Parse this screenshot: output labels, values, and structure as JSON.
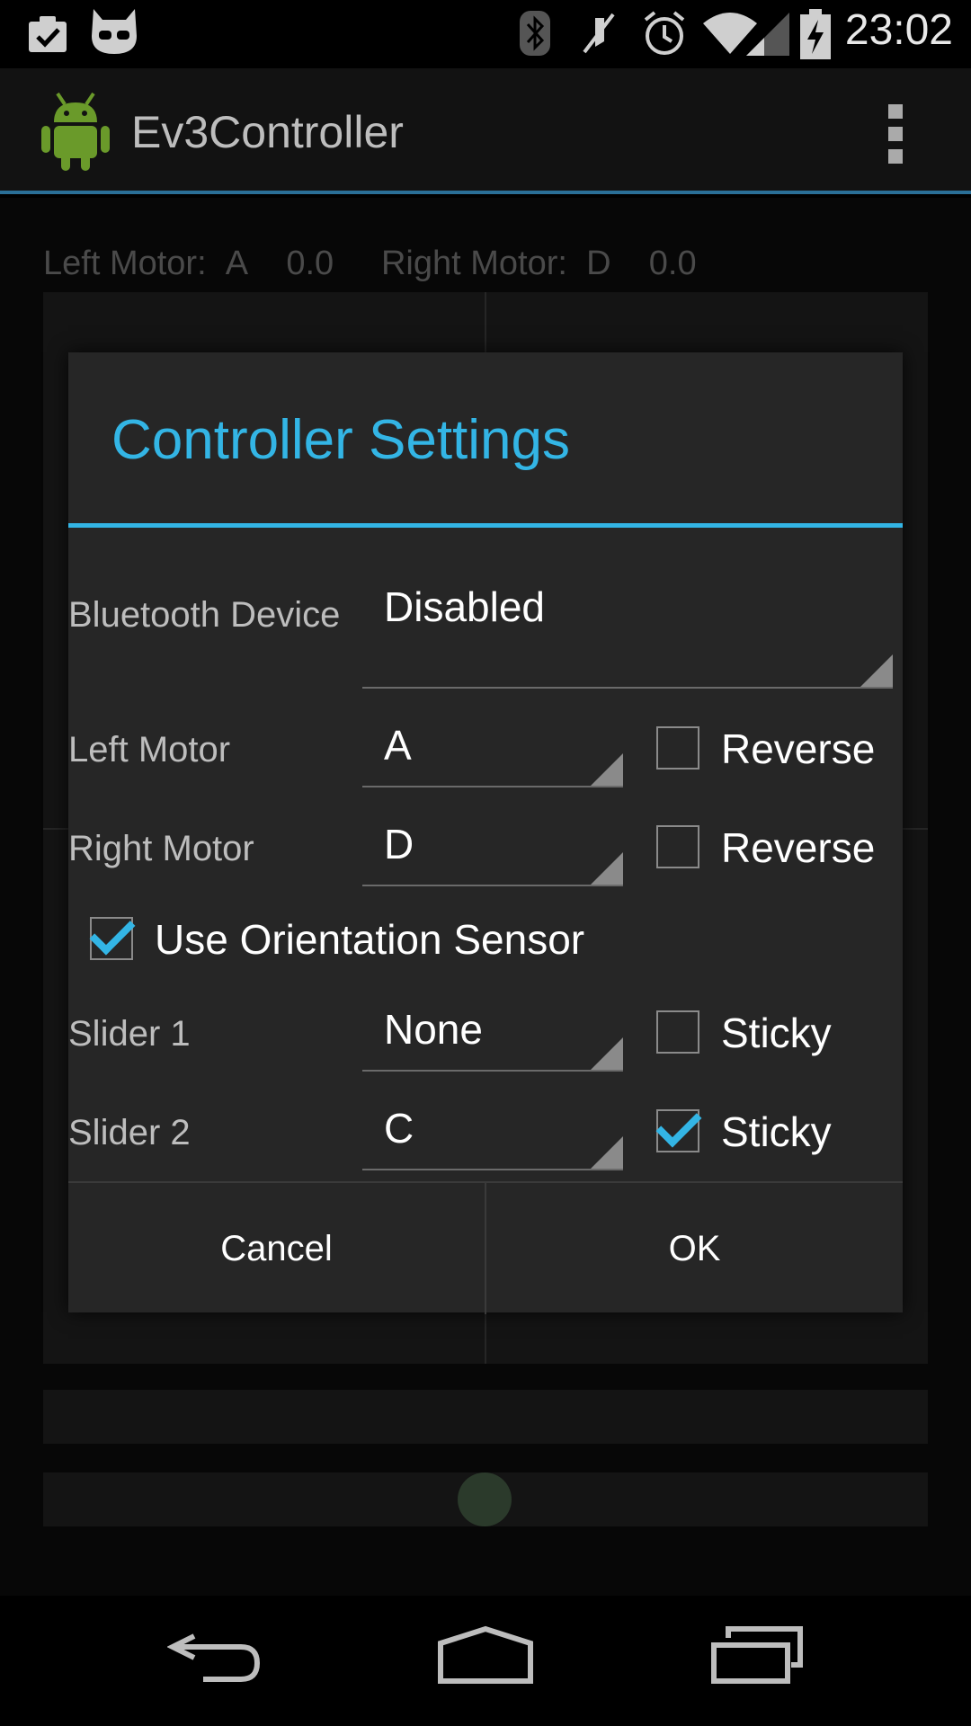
{
  "status_bar": {
    "time": "23:02",
    "icons": [
      "clipboard-check-icon",
      "cyanogen-mascot-icon",
      "bluetooth-icon",
      "muted-icon",
      "alarm-icon",
      "wifi-icon",
      "signal-icon",
      "battery-charging-icon"
    ]
  },
  "action_bar": {
    "title": "Ev3Controller",
    "logo": "android-robot-icon",
    "menu_icon": "overflow-menu-icon"
  },
  "main": {
    "left_motor_label": "Left Motor:",
    "left_motor_port": "A",
    "left_motor_value": "0.0",
    "right_motor_label": "Right Motor:",
    "right_motor_port": "D",
    "right_motor_value": "0.0"
  },
  "dialog": {
    "title": "Controller Settings",
    "bluetooth": {
      "label": "Bluetooth Device",
      "value": "Disabled"
    },
    "left_motor": {
      "label": "Left Motor",
      "value": "A",
      "reverse_label": "Reverse",
      "reverse_checked": false
    },
    "right_motor": {
      "label": "Right Motor",
      "value": "D",
      "reverse_label": "Reverse",
      "reverse_checked": false
    },
    "orientation": {
      "label": "Use Orientation Sensor",
      "checked": true
    },
    "slider1": {
      "label": "Slider 1",
      "value": "None",
      "sticky_label": "Sticky",
      "sticky_checked": false
    },
    "slider2": {
      "label": "Slider 2",
      "value": "C",
      "sticky_label": "Sticky",
      "sticky_checked": true
    },
    "cancel_label": "Cancel",
    "ok_label": "OK"
  },
  "nav_bar": {
    "icons": [
      "back-icon",
      "home-icon",
      "recents-icon"
    ]
  },
  "colors": {
    "accent": "#33b5e5",
    "dialog_bg": "#262626"
  }
}
